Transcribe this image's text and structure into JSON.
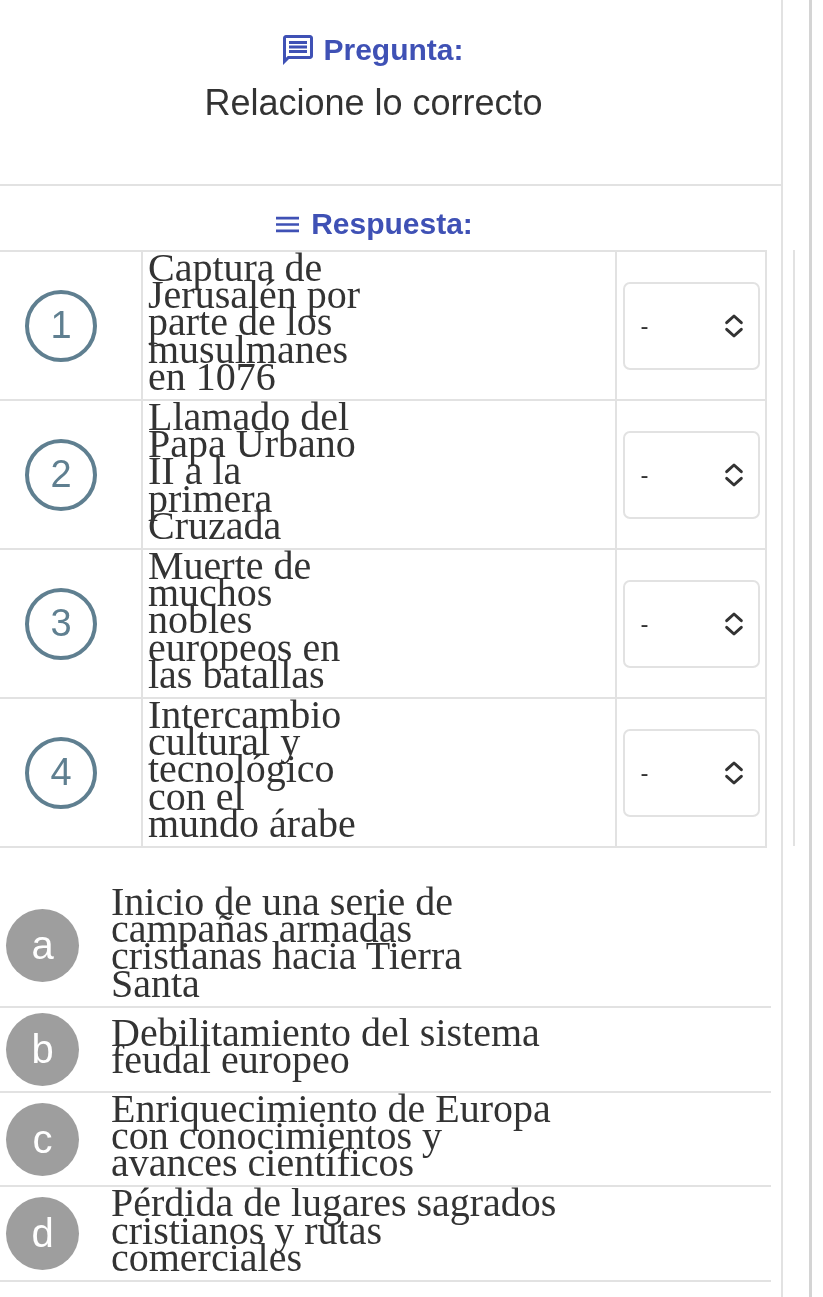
{
  "question": {
    "heading": "Pregunta:",
    "text": "Relacione lo correcto"
  },
  "answer": {
    "heading": "Respuesta:",
    "premises": [
      {
        "number": "1",
        "text": "Captura de Jerusalén por parte de los musulmanes en 1076",
        "value": "-"
      },
      {
        "number": "2",
        "text": "Llamado del Papa Urbano II a la primera Cruzada",
        "value": "-"
      },
      {
        "number": "3",
        "text": "Muerte de muchos nobles europeos en las batallas",
        "value": "-"
      },
      {
        "number": "4",
        "text": "Intercambio cultural y tecnológico con el mundo árabe",
        "value": "-"
      }
    ],
    "options": [
      {
        "letter": "a",
        "text": "Inicio de una serie de campañas armadas cristianas hacia Tierra Santa"
      },
      {
        "letter": "b",
        "text": "Debilitamiento del sistema feudal europeo"
      },
      {
        "letter": "c",
        "text": "Enriquecimiento de Europa con conocimientos y avances científicos"
      },
      {
        "letter": "d",
        "text": "Pérdida de lugares sagrados cristianos y rutas comerciales"
      }
    ]
  }
}
